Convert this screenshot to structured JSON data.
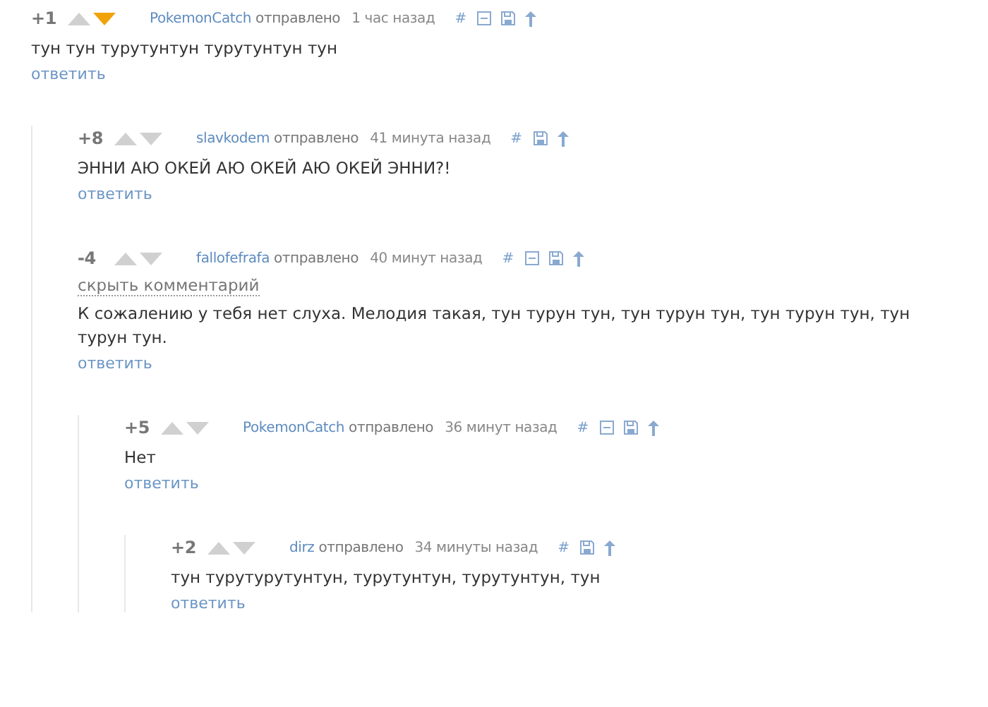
{
  "comments": [
    {
      "rating": "+1",
      "upvoted": false,
      "downvoted": true,
      "author": "PokemonCatch",
      "sent": "отправлено",
      "time": "1 час назад",
      "anchor": "#",
      "collapsible": true,
      "body": "тун тун турутунтун турутунтун тун",
      "reply": "ответить",
      "children": [
        {
          "rating": "+8",
          "upvoted": false,
          "downvoted": false,
          "author": "slavkodem",
          "sent": "отправлено",
          "time": "41 минута назад",
          "anchor": "#",
          "collapsible": false,
          "body": "ЭННИ АЮ ОКЕЙ АЮ ОКЕЙ АЮ ОКЕЙ ЭННИ?!",
          "reply": "ответить"
        },
        {
          "rating": "-4",
          "upvoted": false,
          "downvoted": false,
          "author": "fallofefrafa",
          "sent": "отправлено",
          "time": "40 минут назад",
          "anchor": "#",
          "collapsible": true,
          "hide": "скрыть комментарий",
          "body": "К сожалению у тебя нет слуха. Мелодия такая, тун турун тун, тун турун тун, тун турун тун, тун турун тун.",
          "reply": "ответить",
          "children": [
            {
              "rating": "+5",
              "upvoted": false,
              "downvoted": false,
              "author": "PokemonCatch",
              "sent": "отправлено",
              "time": "36 минут назад",
              "anchor": "#",
              "collapsible": true,
              "body": "Нет",
              "reply": "ответить",
              "children": [
                {
                  "rating": "+2",
                  "upvoted": false,
                  "downvoted": false,
                  "author": "dirz",
                  "sent": "отправлено",
                  "time": "34 минуты назад",
                  "anchor": "#",
                  "collapsible": false,
                  "body": "тун турутурутунтун, турутунтун, турутунтун, тун",
                  "reply": "ответить"
                }
              ]
            }
          ]
        }
      ]
    }
  ]
}
